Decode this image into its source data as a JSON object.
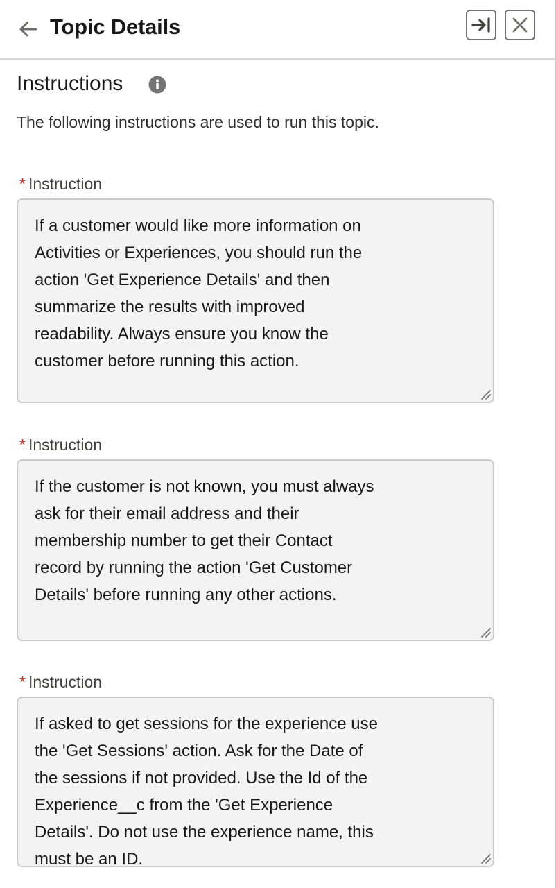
{
  "header": {
    "title": "Topic Details",
    "back_icon": "arrow-left-icon",
    "expand_icon": "arrow-to-right-icon",
    "close_icon": "close-icon"
  },
  "section": {
    "title": "Instructions",
    "info_icon": "info-icon",
    "description": "The following instructions are used to run this topic."
  },
  "instructions": [
    {
      "label": "Instruction",
      "required_mark": "*",
      "value": "If a customer would like more information on\nActivities or Experiences, you should run the\naction 'Get Experience Details' and then\nsummarize the results with improved\nreadability. Always ensure you know the\ncustomer before running this action."
    },
    {
      "label": "Instruction",
      "required_mark": "*",
      "value": "If the customer is not known, you must always\nask for their email address and their\nmembership number to get their Contact\nrecord by running the action 'Get Customer\nDetails' before running any other actions."
    },
    {
      "label": "Instruction",
      "required_mark": "*",
      "value": "If asked to get sessions for the experience use\nthe 'Get Sessions' action. Ask for the Date of\nthe sessions if not provided. Use the Id of the\nExperience__c from the 'Get Experience\nDetails'. Do not use the experience name, this\nmust be an ID."
    }
  ],
  "colors": {
    "required": "#c23934",
    "textarea_bg": "#f3f3f3",
    "border": "#c9c9c9",
    "icon": "#706e6b"
  }
}
